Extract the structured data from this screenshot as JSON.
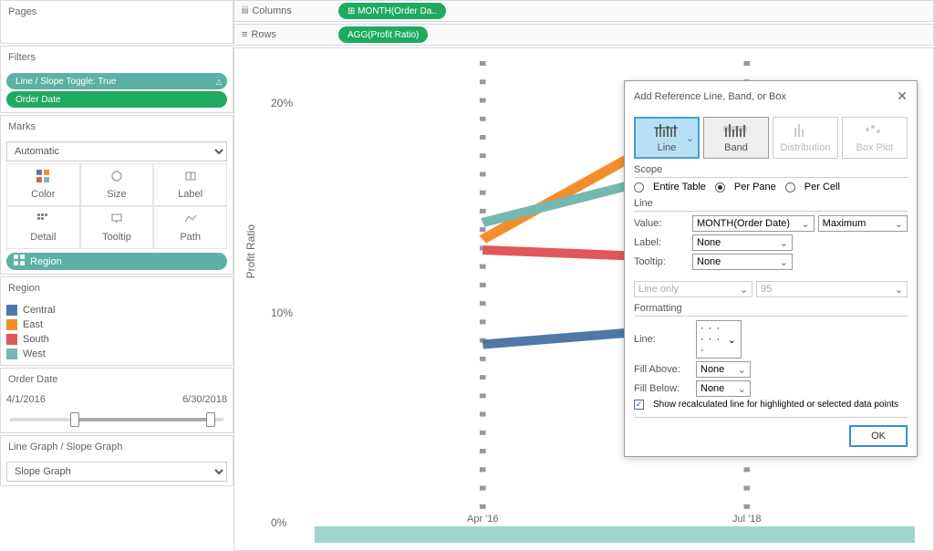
{
  "panels": {
    "pages": "Pages",
    "filters": "Filters",
    "marks": "Marks",
    "region": "Region",
    "order_date": "Order Date",
    "toggle": "Line Graph / Slope Graph"
  },
  "filters": {
    "pill1": "Line / Slope Toggle: True",
    "pill2": "Order Date"
  },
  "marks": {
    "type": "Automatic",
    "color": "Color",
    "size": "Size",
    "label": "Label",
    "detail": "Detail",
    "tooltip": "Tooltip",
    "path": "Path",
    "region_pill": "Region"
  },
  "legend": {
    "items": [
      {
        "label": "Central",
        "color": "#4e79a7"
      },
      {
        "label": "East",
        "color": "#f28e2b"
      },
      {
        "label": "South",
        "color": "#e15759"
      },
      {
        "label": "West",
        "color": "#76b7b2"
      }
    ]
  },
  "date_range": {
    "start": "4/1/2016",
    "end": "6/30/2018"
  },
  "toggle_select": "Slope Graph",
  "shelves": {
    "columns": "Columns",
    "rows": "Rows",
    "col_pill": "⊞ MONTH(Order Da..",
    "row_pill": "AGG(Profit Ratio)"
  },
  "chart_data": {
    "type": "line",
    "ylabel": "Profit Ratio",
    "categories": [
      "Apr '16",
      "Jul '18"
    ],
    "yticks": [
      "0%",
      "10%",
      "20%"
    ],
    "ylim": [
      0,
      0.22
    ],
    "series": [
      {
        "name": "Central",
        "values": [
          0.085,
          0.095
        ],
        "color": "#4e79a7"
      },
      {
        "name": "East",
        "values": [
          0.135,
          0.205
        ],
        "color": "#f28e2b"
      },
      {
        "name": "South",
        "values": [
          0.13,
          0.125
        ],
        "color": "#e15759"
      },
      {
        "name": "West",
        "values": [
          0.143,
          0.175
        ],
        "color": "#76b7b2"
      }
    ]
  },
  "dialog": {
    "title": "Add Reference Line, Band, or Box",
    "tabs": {
      "line": "Line",
      "band": "Band",
      "dist": "Distribution",
      "box": "Box Plot"
    },
    "scope_hdr": "Scope",
    "scope": {
      "entire": "Entire Table",
      "pane": "Per Pane",
      "cell": "Per Cell"
    },
    "line_hdr": "Line",
    "value_lbl": "Value:",
    "value_sel": "MONTH(Order Date)",
    "agg_sel": "Maximum",
    "label_lbl": "Label:",
    "label_sel": "None",
    "tooltip_lbl": "Tooltip:",
    "tooltip_sel": "None",
    "lineonly": "Line only",
    "conf": "95",
    "fmt_hdr": "Formatting",
    "line_lbl": "Line:",
    "above_lbl": "Fill Above:",
    "above_sel": "None",
    "below_lbl": "Fill Below:",
    "below_sel": "None",
    "recalc": "Show recalculated line for highlighted or selected data points",
    "ok": "OK"
  }
}
